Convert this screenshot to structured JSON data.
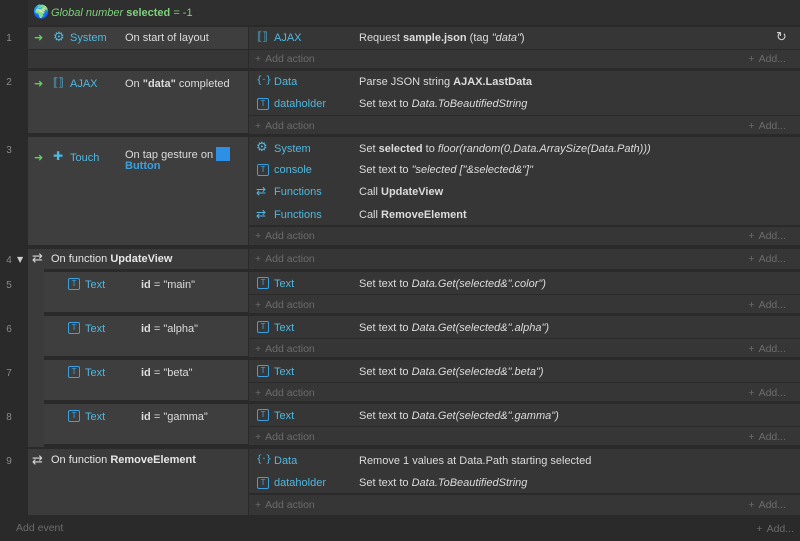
{
  "global": {
    "prefix": "Global number",
    "name": "selected",
    "rest": "= -1"
  },
  "rows": {
    "n1": "1",
    "n2": "2",
    "n3": "3",
    "n4": "4",
    "n5": "5",
    "n6": "6",
    "n7": "7",
    "n8": "8",
    "n9": "9"
  },
  "e1": {
    "obj": "System",
    "cond": "On start of layout",
    "act_obj": "AJAX",
    "act_a": "Request ",
    "act_b": "sample.json",
    "act_c": " (tag ",
    "act_d": "\"data\"",
    "act_e": ")"
  },
  "e2": {
    "obj": "AJAX",
    "cond_a": "On ",
    "cond_b": "\"data\"",
    "cond_c": " completed",
    "a1_obj": "Data",
    "a1_a": "Parse JSON string ",
    "a1_b": "AJAX.LastData",
    "a2_obj": "dataholder",
    "a2_a": "Set text to ",
    "a2_b": "Data.ToBeautifiedString"
  },
  "e3": {
    "obj": "Touch",
    "cond_a": "On tap gesture on",
    "cond_b": "Button",
    "a1_obj": "System",
    "a1_a": "Set ",
    "a1_b": "selected",
    "a1_c": " to ",
    "a1_d": "floor(random(0,Data.ArraySize(Data.Path)))",
    "a2_obj": "console",
    "a2_a": "Set text to ",
    "a2_b": "\"selected [\"&selected&\"]\"",
    "a3_obj": "Functions",
    "a3_a": "Call ",
    "a3_b": "UpdateView",
    "a4_obj": "Functions",
    "a4_a": "Call ",
    "a4_b": "RemoveElement"
  },
  "e4": {
    "a": "On function ",
    "b": "UpdateView"
  },
  "e5": {
    "obj": "Text",
    "id": "id",
    "val": " = \"main\"",
    "act_obj": "Text",
    "act_a": "Set text to ",
    "act_b": "Data.Get(selected&\".color\")"
  },
  "e6": {
    "obj": "Text",
    "id": "id",
    "val": " = \"alpha\"",
    "act_obj": "Text",
    "act_a": "Set text to ",
    "act_b": "Data.Get(selected&\".alpha\")"
  },
  "e7": {
    "obj": "Text",
    "id": "id",
    "val": " = \"beta\"",
    "act_obj": "Text",
    "act_a": "Set text to ",
    "act_b": "Data.Get(selected&\".beta\")"
  },
  "e8": {
    "obj": "Text",
    "id": "id",
    "val": " = \"gamma\"",
    "act_obj": "Text",
    "act_a": "Set text to ",
    "act_b": "Data.Get(selected&\".gamma\")"
  },
  "e9": {
    "a": "On function ",
    "b": "RemoveElement",
    "a1_obj": "Data",
    "a1_a": "Remove 1 values at Data.Path starting selected",
    "a2_obj": "dataholder",
    "a2_a": "Set text to ",
    "a2_b": "Data.ToBeautifiedString"
  },
  "labels": {
    "add_action": "Add action",
    "add": "Add...",
    "add_event": "Add event",
    "plus": "+"
  }
}
